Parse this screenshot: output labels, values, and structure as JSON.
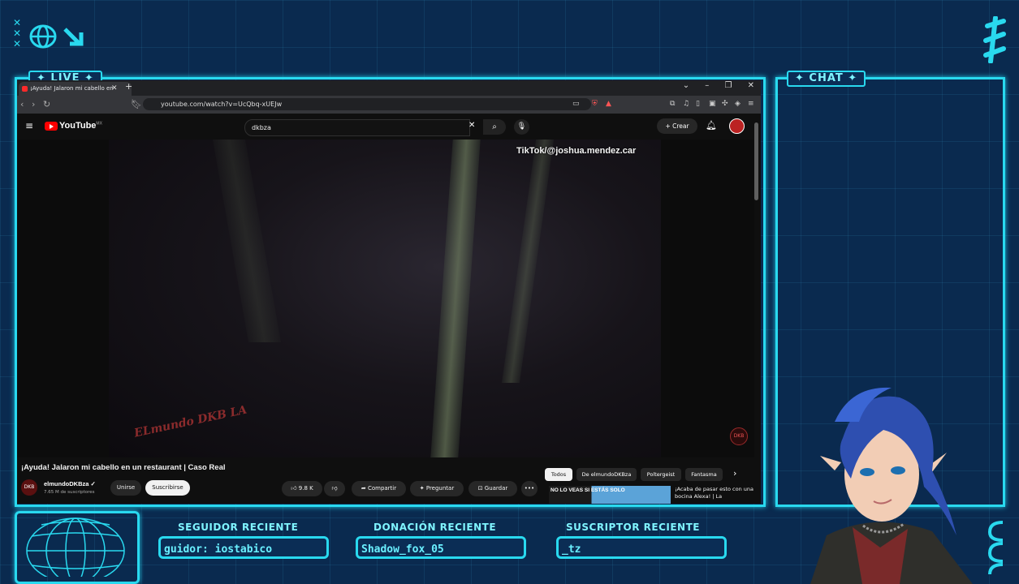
{
  "overlay": {
    "live_label": "✦ LIVE ✦",
    "chat_label": "✦ CHAT ✦",
    "stats": [
      {
        "heading": "SEGUIDOR RECIENTE",
        "value": "guidor: iostabico"
      },
      {
        "heading": "DONACIÓN RECIENTE",
        "value": "Shadow_fox_05"
      },
      {
        "heading": "SUSCRIPTOR RECIENTE",
        "value": "_tz"
      }
    ]
  },
  "browser": {
    "tab_title": "¡Ayuda! Jalaron mi cabello en",
    "url": "youtube.com/watch?v=UcQbq-xUEJw"
  },
  "youtube": {
    "logo": "YouTube",
    "region": "MX",
    "search_value": "dkbza",
    "create_label": "Crear",
    "video_overlay_text": "TikTok/@joshua.mendez.car",
    "video_watermark": "ELmundo DKB LA",
    "title": "¡Ayuda! Jalaron mi cabello en un restaurant | Caso Real",
    "channel_name": "elmundoDKBza",
    "channel_subs": "7.65 M de suscriptores",
    "join_label": "Unirse",
    "subscribe_label": "Suscribirse",
    "likes": "9.8 K",
    "share_label": "Compartir",
    "ask_label": "Preguntar",
    "save_label": "Guardar",
    "more_label": "•••",
    "chips": [
      "Todos",
      "De elmundoDKBza",
      "Poltergeist",
      "Fantasma"
    ],
    "rec_thumb_text": "NO LO VEAS SI ESTÁS SOLO",
    "rec_title": "¡Acaba de pasar esto con una bocina Alexa! | La"
  },
  "colors": {
    "accent": "#29d9ef",
    "background": "#0a2a4f",
    "youtube_red": "#ff0000"
  }
}
